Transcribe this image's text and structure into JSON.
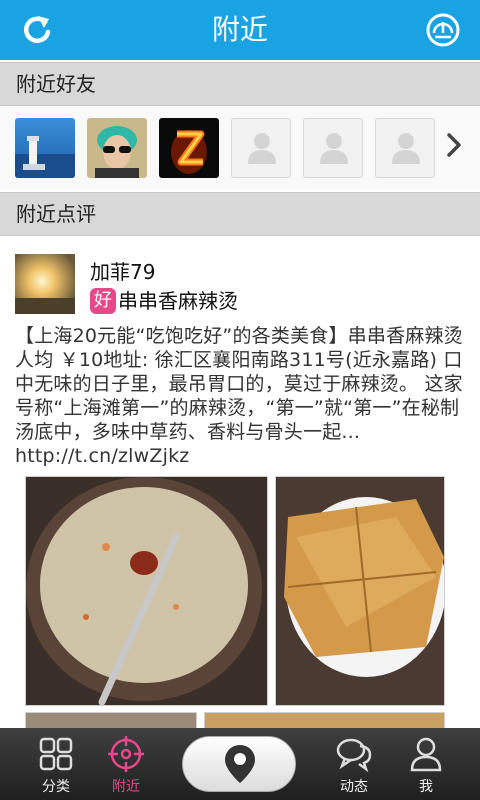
{
  "header": {
    "title": "附近"
  },
  "friends": {
    "section_title": "附近好友",
    "avatars": [
      "lighthouse-photo",
      "sunglasses-portrait",
      "flame-z-logo",
      "default-avatar",
      "default-avatar",
      "default-avatar"
    ]
  },
  "reviews": {
    "section_title": "附近点评",
    "item": {
      "username": "加菲79",
      "badge": "好",
      "shop_name": "串串香麻辣烫",
      "text": "【上海20元能“吃饱吃好”的各类美食】串串香麻辣烫人均 ￥10地址: 徐汇区襄阳南路311号(近永嘉路) 口中无味的日子里，最吊胃口的，莫过于麻辣烫。 这家号称“上海滩第一”的麻辣烫，“第一”就“第一”在秘制汤底中，多味中草药、香料与骨头一起... http://t.cn/zlwZjkz"
    }
  },
  "bottom_nav": {
    "items": [
      {
        "label": "分类",
        "icon": "grid-icon"
      },
      {
        "label": "附近",
        "icon": "crosshair-icon",
        "active": true
      },
      {
        "label": "",
        "icon": "location-pin-icon"
      },
      {
        "label": "动态",
        "icon": "chat-bubbles-icon"
      },
      {
        "label": "我",
        "icon": "person-icon"
      }
    ]
  },
  "colors": {
    "header_bg": "#1aa3e3",
    "accent_pink": "#e8488a",
    "section_bg": "#d8d8d8"
  }
}
